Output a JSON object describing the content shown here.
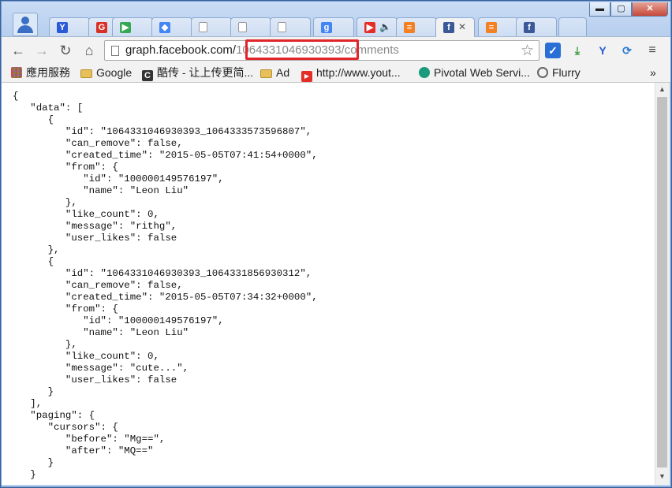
{
  "browser": {
    "window_buttons": {
      "minimize": "▬",
      "maximize": "▢",
      "close": "✕"
    },
    "tabs": [
      {
        "icon": "y-combinator-icon",
        "glyph": "Y",
        "color": "#2a5bd7"
      },
      {
        "icon": "red-logo-icon",
        "glyph": "G",
        "color": "#d93025"
      },
      {
        "icon": "play-store-icon",
        "glyph": "▶",
        "color": "#34a853"
      },
      {
        "icon": "colored-logo-icon",
        "glyph": "◆",
        "color": "#4285f4"
      },
      {
        "icon": "page-icon",
        "glyph": "",
        "color": "#ffffff"
      },
      {
        "icon": "page-icon",
        "glyph": "",
        "color": "#ffffff"
      },
      {
        "icon": "page-icon",
        "glyph": "",
        "color": "#ffffff"
      },
      {
        "icon": "google-icon",
        "glyph": "g",
        "color": "#4285f4"
      },
      {
        "icon": "youtube-icon",
        "glyph": "▶",
        "color": "#e52d27",
        "extra": "🔈"
      },
      {
        "icon": "stackoverflow-icon",
        "glyph": "≡",
        "color": "#f48024"
      },
      {
        "icon": "facebook-icon",
        "glyph": "f",
        "color": "#3b5998",
        "active": true,
        "extra": "✕"
      },
      {
        "icon": "stackoverflow-icon",
        "glyph": "≡",
        "color": "#f48024"
      },
      {
        "icon": "facebook-icon",
        "glyph": "f",
        "color": "#3b5998"
      }
    ],
    "address": {
      "domain": "graph.facebook.com/",
      "object_id": "1064331046930393",
      "path": "/comments"
    },
    "bookmarks": [
      {
        "label": "應用服務",
        "icon": "apps-grid-icon"
      },
      {
        "label": "Google",
        "icon": "folder-icon"
      },
      {
        "label": "酷传 - 让上传更简...",
        "icon": "c-logo-icon"
      },
      {
        "label": "Ad",
        "icon": "folder-icon"
      },
      {
        "label": "http://www.yout...",
        "icon": "youtube-icon"
      },
      {
        "label": "Pivotal Web Servi...",
        "icon": "pivotal-icon"
      },
      {
        "label": "Flurry",
        "icon": "flurry-icon"
      }
    ],
    "bookmarks_more": "»"
  },
  "json_text": "{\n   \"data\": [\n      {\n         \"id\": \"1064331046930393_1064333573596807\",\n         \"can_remove\": false,\n         \"created_time\": \"2015-05-05T07:41:54+0000\",\n         \"from\": {\n            \"id\": \"100000149576197\",\n            \"name\": \"Leon Liu\"\n         },\n         \"like_count\": 0,\n         \"message\": \"rithg\",\n         \"user_likes\": false\n      },\n      {\n         \"id\": \"1064331046930393_1064331856930312\",\n         \"can_remove\": false,\n         \"created_time\": \"2015-05-05T07:34:32+0000\",\n         \"from\": {\n            \"id\": \"100000149576197\",\n            \"name\": \"Leon Liu\"\n         },\n         \"like_count\": 0,\n         \"message\": \"cute...\",\n         \"user_likes\": false\n      }\n   ],\n   \"paging\": {\n      \"cursors\": {\n         \"before\": \"Mg==\",\n         \"after\": \"MQ==\"\n      }\n   }"
}
